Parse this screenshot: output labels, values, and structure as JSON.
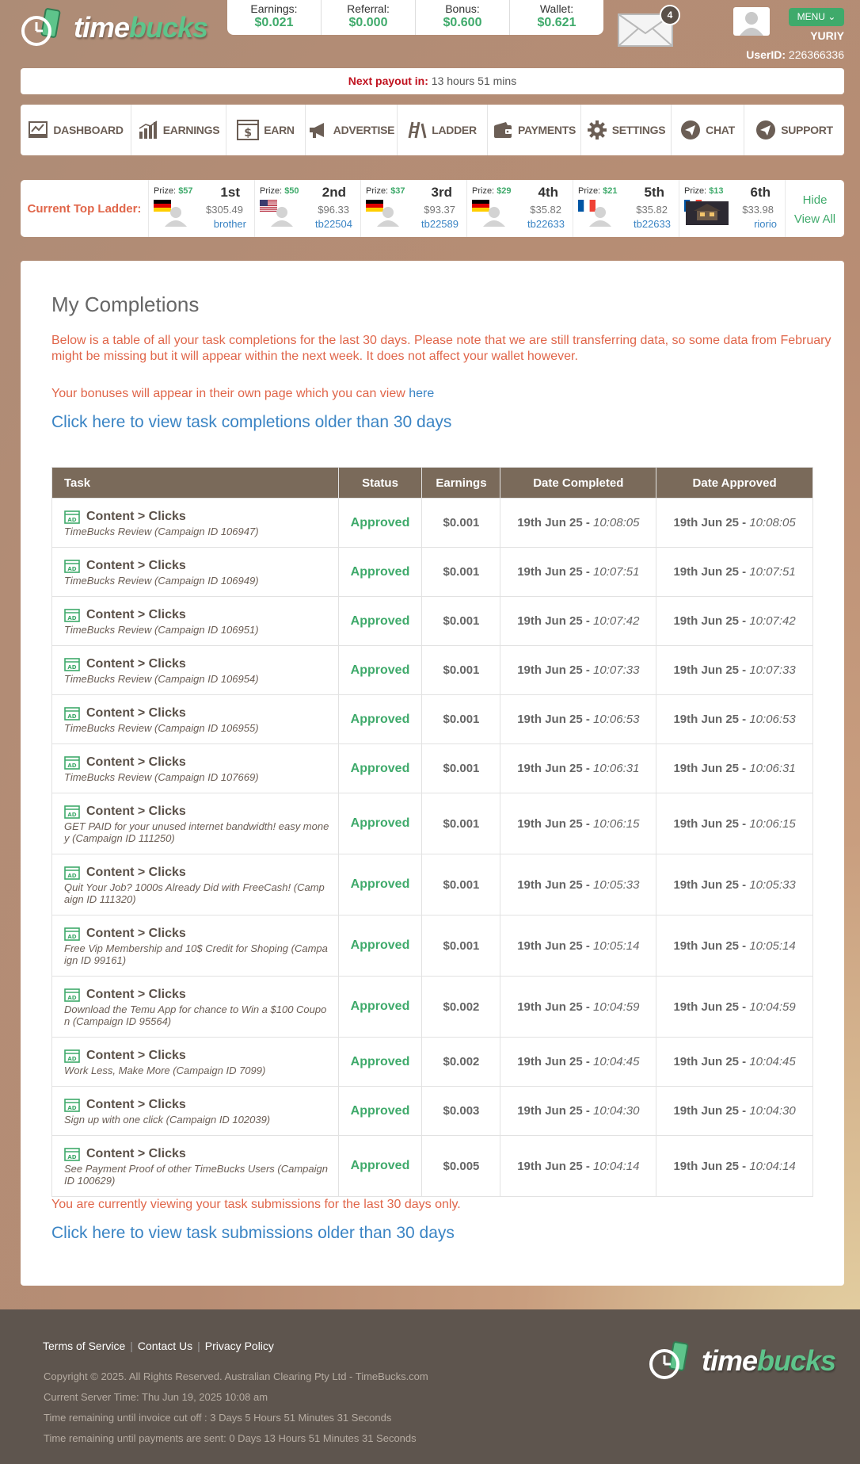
{
  "header": {
    "logo_word_1": "time",
    "logo_word_2": "bucks",
    "stats": [
      {
        "label": "Earnings:",
        "value": "$0.021"
      },
      {
        "label": "Referral:",
        "value": "$0.000"
      },
      {
        "label": "Bonus:",
        "value": "$0.600"
      },
      {
        "label": "Wallet:",
        "value": "$0.621"
      }
    ],
    "mail_count": "4",
    "menu_label": "MENU",
    "username": "YURIY",
    "userid_label": "UserID:",
    "userid_value": "226366336"
  },
  "payout": {
    "label": "Next payout in:",
    "value": "13 hours 51 mins"
  },
  "nav": [
    {
      "label": "DASHBOARD",
      "icon": "dashboard-icon"
    },
    {
      "label": "EARNINGS",
      "icon": "bar-chart-icon"
    },
    {
      "label": "EARN",
      "icon": "dollar-window-icon"
    },
    {
      "label": "ADVERTISE",
      "icon": "megaphone-icon"
    },
    {
      "label": "LADDER",
      "icon": "ladder-icon"
    },
    {
      "label": "PAYMENTS",
      "icon": "wallet-icon"
    },
    {
      "label": "SETTINGS",
      "icon": "gear-icon"
    },
    {
      "label": "CHAT",
      "icon": "paper-plane-icon"
    },
    {
      "label": "SUPPORT",
      "icon": "paper-plane-icon"
    }
  ],
  "ladder": {
    "title": "Current Top Ladder:",
    "prize_label": "Prize:",
    "ranks": [
      {
        "prize": "$57",
        "place": "1st",
        "amount": "$305.49",
        "user": "brother",
        "flag": "germany"
      },
      {
        "prize": "$50",
        "place": "2nd",
        "amount": "$96.33",
        "user": "tb22504",
        "flag": "usa"
      },
      {
        "prize": "$37",
        "place": "3rd",
        "amount": "$93.37",
        "user": "tb22589",
        "flag": "germany"
      },
      {
        "prize": "$29",
        "place": "4th",
        "amount": "$35.82",
        "user": "tb22633",
        "flag": "germany"
      },
      {
        "prize": "$21",
        "place": "5th",
        "amount": "$35.82",
        "user": "tb22633",
        "flag": "france"
      },
      {
        "prize": "$13",
        "place": "6th",
        "amount": "$33.98",
        "user": "riorio",
        "flag": "france"
      }
    ],
    "hide_label": "Hide",
    "view_all_label": "View All"
  },
  "main": {
    "title": "My Completions",
    "notice": "Below is a table of all your task completions for the last 30 days. Please note that we are still transferring data, so some data from February might be missing but it will appear within the next week. It does not affect your wallet however.",
    "bonus_text": "Your bonuses will appear in their own page which you can view ",
    "bonus_link": "here",
    "older_link": "Click here to view task completions older than 30 days",
    "columns": [
      "Task",
      "Status",
      "Earnings",
      "Date Completed",
      "Date Approved"
    ],
    "rows": [
      {
        "task": "Content > Clicks",
        "desc": "TimeBucks Review (Campaign ID 106947)",
        "status": "Approved",
        "earnings": "$0.001",
        "date": "19th Jun 25 - ",
        "completed_time": "10:08:05",
        "approved_time": "10:08:05"
      },
      {
        "task": "Content > Clicks",
        "desc": "TimeBucks Review (Campaign ID 106949)",
        "status": "Approved",
        "earnings": "$0.001",
        "date": "19th Jun 25 - ",
        "completed_time": "10:07:51",
        "approved_time": "10:07:51"
      },
      {
        "task": "Content > Clicks",
        "desc": "TimeBucks Review (Campaign ID 106951)",
        "status": "Approved",
        "earnings": "$0.001",
        "date": "19th Jun 25 - ",
        "completed_time": "10:07:42",
        "approved_time": "10:07:42"
      },
      {
        "task": "Content > Clicks",
        "desc": "TimeBucks Review (Campaign ID 106954)",
        "status": "Approved",
        "earnings": "$0.001",
        "date": "19th Jun 25 - ",
        "completed_time": "10:07:33",
        "approved_time": "10:07:33"
      },
      {
        "task": "Content > Clicks",
        "desc": "TimeBucks Review (Campaign ID 106955)",
        "status": "Approved",
        "earnings": "$0.001",
        "date": "19th Jun 25 - ",
        "completed_time": "10:06:53",
        "approved_time": "10:06:53"
      },
      {
        "task": "Content > Clicks",
        "desc": "TimeBucks Review (Campaign ID 107669)",
        "status": "Approved",
        "earnings": "$0.001",
        "date": "19th Jun 25 - ",
        "completed_time": "10:06:31",
        "approved_time": "10:06:31"
      },
      {
        "task": "Content > Clicks",
        "desc": "GET PAID for your unused internet bandwidth! easy money (Campaign ID 111250)",
        "status": "Approved",
        "earnings": "$0.001",
        "date": "19th Jun 25 - ",
        "completed_time": "10:06:15",
        "approved_time": "10:06:15"
      },
      {
        "task": "Content > Clicks",
        "desc": "Quit Your Job? 1000s Already Did with FreeCash! (Campaign ID 111320)",
        "status": "Approved",
        "earnings": "$0.001",
        "date": "19th Jun 25 - ",
        "completed_time": "10:05:33",
        "approved_time": "10:05:33"
      },
      {
        "task": "Content > Clicks",
        "desc": "Free Vip Membership and 10$ Credit for Shoping (Campaign ID 99161)",
        "status": "Approved",
        "earnings": "$0.001",
        "date": "19th Jun 25 - ",
        "completed_time": "10:05:14",
        "approved_time": "10:05:14"
      },
      {
        "task": "Content > Clicks",
        "desc": "Download the Temu App for chance to Win a $100 Coupon (Campaign ID 95564)",
        "status": "Approved",
        "earnings": "$0.002",
        "date": "19th Jun 25 - ",
        "completed_time": "10:04:59",
        "approved_time": "10:04:59"
      },
      {
        "task": "Content > Clicks",
        "desc": "Work Less, Make More (Campaign ID 7099)",
        "status": "Approved",
        "earnings": "$0.002",
        "date": "19th Jun 25 - ",
        "completed_time": "10:04:45",
        "approved_time": "10:04:45"
      },
      {
        "task": "Content > Clicks",
        "desc": "Sign up with one click (Campaign ID 102039)",
        "status": "Approved",
        "earnings": "$0.003",
        "date": "19th Jun 25 - ",
        "completed_time": "10:04:30",
        "approved_time": "10:04:30"
      },
      {
        "task": "Content > Clicks",
        "desc": "See Payment Proof of other TimeBucks Users (Campaign ID 100629)",
        "status": "Approved",
        "earnings": "$0.005",
        "date": "19th Jun 25 - ",
        "completed_time": "10:04:14",
        "approved_time": "10:04:14"
      }
    ],
    "bottom_note": "You are currently viewing your task submissions for the last 30 days only.",
    "older_link_2": "Click here to view task submissions older than 30 days"
  },
  "footer": {
    "links": [
      "Terms of Service",
      "Contact Us",
      "Privacy Policy"
    ],
    "copyright": "Copyright © 2025. All Rights Reserved. Australian Clearing Pty Ltd - TimeBucks.com",
    "server_time": "Current Server Time: Thu Jun 19, 2025 10:08 am",
    "invoice_cutoff": "Time remaining until invoice cut off : 3 Days 5 Hours 51 Minutes 31 Seconds",
    "payments_sent": "Time remaining until payments are sent: 0 Days 13 Hours 51 Minutes 31 Seconds"
  },
  "colors": {
    "accent_green": "#3faa6b",
    "link_blue": "#3a84c4",
    "notice_orange": "#e0664a",
    "header_brown": "#7a6a5a",
    "payout_red": "#c0121f"
  }
}
